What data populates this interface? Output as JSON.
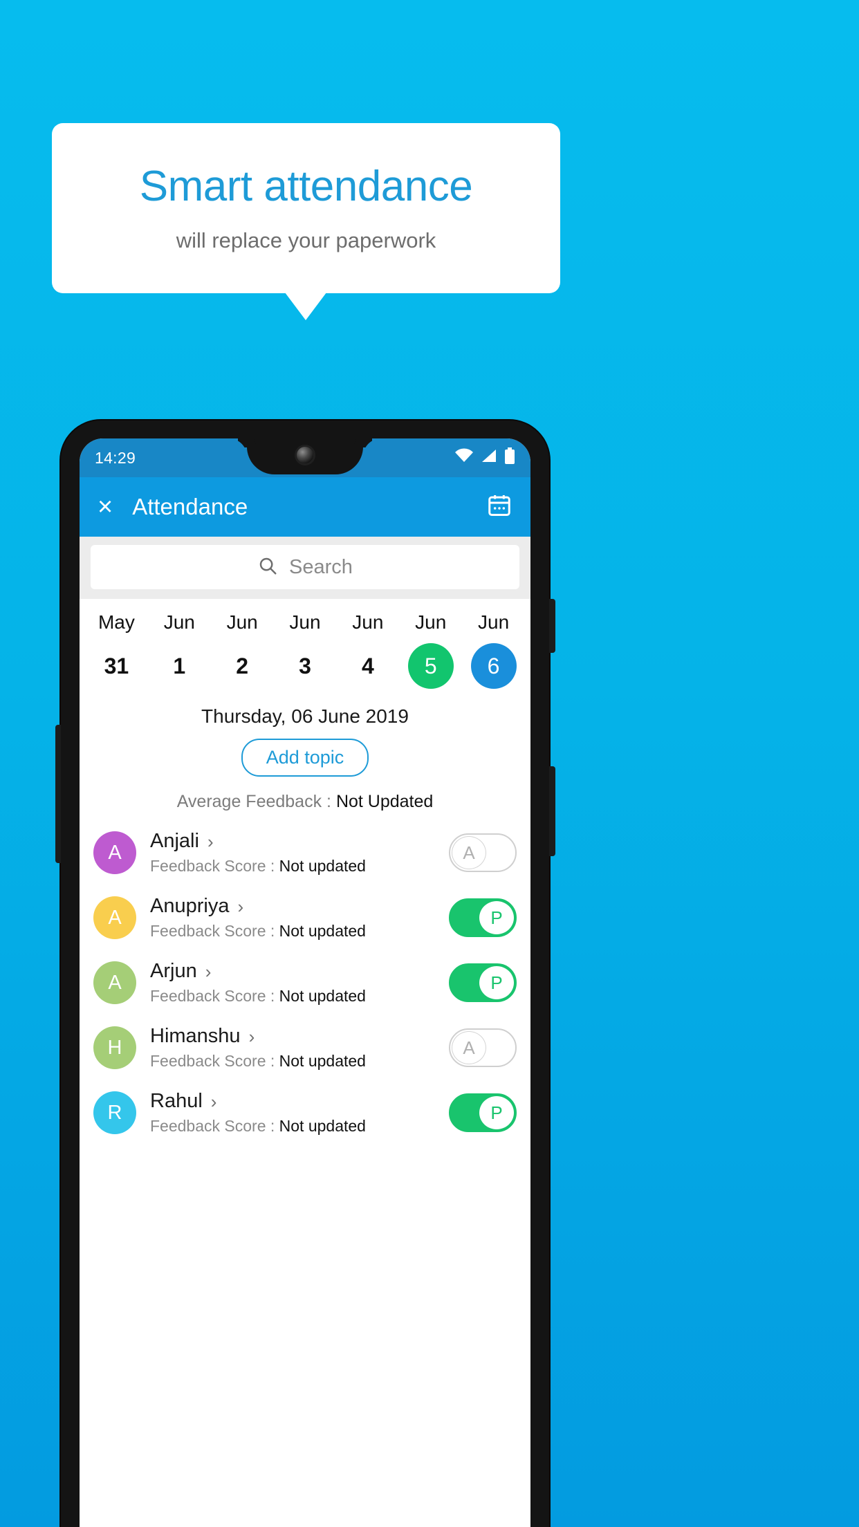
{
  "promo": {
    "title": "Smart attendance",
    "subtitle": "will replace your paperwork"
  },
  "colors": {
    "background": "#05B5EA",
    "brand_blue": "#0D9AE0",
    "accent_blue": "#1E9BD7",
    "present_green": "#19C46D",
    "today_green": "#12C56E",
    "selected_blue": "#1A8FDB"
  },
  "phone": {
    "status_bar": {
      "time": "14:29",
      "icons": [
        "wifi-icon",
        "signal-icon",
        "battery-icon"
      ]
    },
    "app_bar": {
      "close_label": "×",
      "title": "Attendance",
      "calendar_icon": "calendar-icon"
    },
    "search": {
      "placeholder": "Search",
      "value": "",
      "icon": "search-icon"
    },
    "dates": [
      {
        "month": "May",
        "day": "31",
        "state": "normal"
      },
      {
        "month": "Jun",
        "day": "1",
        "state": "normal"
      },
      {
        "month": "Jun",
        "day": "2",
        "state": "normal"
      },
      {
        "month": "Jun",
        "day": "3",
        "state": "normal"
      },
      {
        "month": "Jun",
        "day": "4",
        "state": "normal"
      },
      {
        "month": "Jun",
        "day": "5",
        "state": "today"
      },
      {
        "month": "Jun",
        "day": "6",
        "state": "selected"
      }
    ],
    "day_heading": "Thursday, 06 June 2019",
    "add_topic_label": "Add topic",
    "average_feedback": {
      "label": "Average Feedback : ",
      "value": "Not Updated"
    },
    "score_label": "Feedback Score : ",
    "students": [
      {
        "name": "Anjali",
        "initial": "A",
        "avatar_color": "#BE5BD0",
        "score": "Not updated",
        "attendance": "A",
        "attendance_state": "absent"
      },
      {
        "name": "Anupriya",
        "initial": "A",
        "avatar_color": "#F9CE4E",
        "score": "Not updated",
        "attendance": "P",
        "attendance_state": "present"
      },
      {
        "name": "Arjun",
        "initial": "A",
        "avatar_color": "#A5CE77",
        "score": "Not updated",
        "attendance": "P",
        "attendance_state": "present"
      },
      {
        "name": "Himanshu",
        "initial": "H",
        "avatar_color": "#A5CE77",
        "score": "Not updated",
        "attendance": "A",
        "attendance_state": "absent"
      },
      {
        "name": "Rahul",
        "initial": "R",
        "avatar_color": "#34C6EB",
        "score": "Not updated",
        "attendance": "P",
        "attendance_state": "present"
      }
    ]
  }
}
